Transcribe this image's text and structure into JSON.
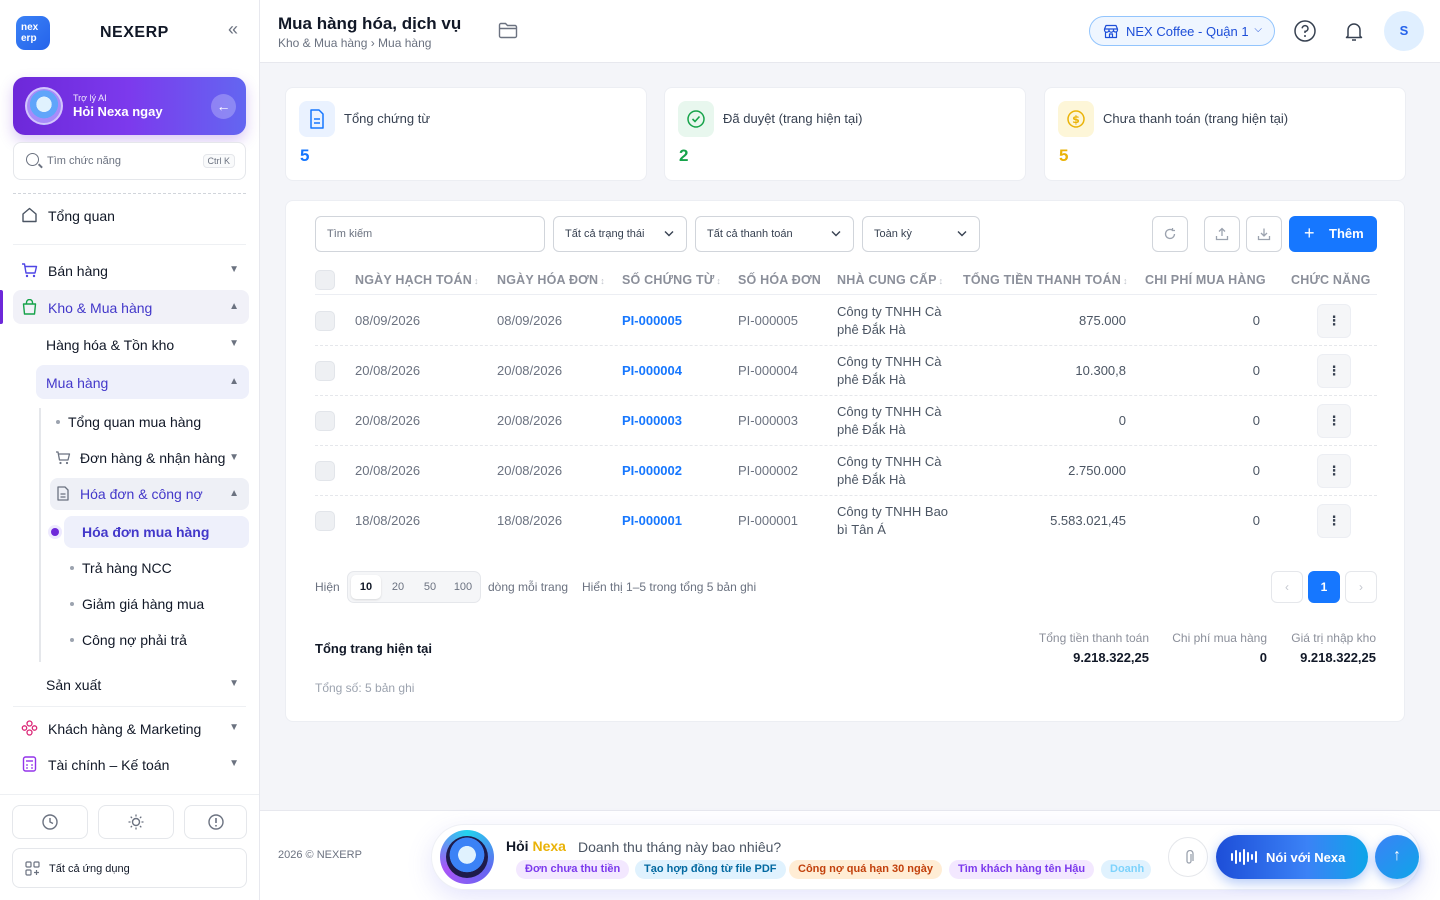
{
  "brand": {
    "logo": "nex erp",
    "name": "NEXERP"
  },
  "ai_card": {
    "small": "Trợ lý AI",
    "big": "Hỏi Nexa ngay"
  },
  "side_search": {
    "placeholder": "Tìm chức năng",
    "shortcut": "Ctrl K"
  },
  "nav": {
    "overview": "Tổng quan",
    "sales": "Bán hàng",
    "warehouse": "Kho & Mua hàng",
    "goods": "Hàng hóa & Tồn kho",
    "purchasing": "Mua hàng",
    "purchase_overview": "Tổng quan mua hàng",
    "orders": "Đơn hàng & nhận hàng",
    "invoices": "Hóa đơn & công nợ",
    "purchase_invoice": "Hóa đơn mua hàng",
    "returns": "Trả hàng NCC",
    "discounts": "Giảm giá hàng mua",
    "payables": "Công nợ phải trả",
    "production": "Sản xuất",
    "customers": "Khách hàng & Marketing",
    "finance": "Tài chính – Kế toán"
  },
  "all_apps": "Tất cả ứng dụng",
  "header": {
    "title": "Mua hàng hóa, dịch vụ",
    "breadcrumb": "Kho & Mua hàng › Mua hàng",
    "branch": "NEX Coffee - Quận 1",
    "avatar": "S"
  },
  "stats": [
    {
      "label": "Tổng chứng từ",
      "value": "5",
      "color": "#1677ff"
    },
    {
      "label": "Đã duyệt (trang hiện tại)",
      "value": "2",
      "color": "#16a34a"
    },
    {
      "label": "Chưa thanh toán (trang hiện tại)",
      "value": "5",
      "color": "#eab308"
    }
  ],
  "filters": {
    "search_placeholder": "Tìm kiếm",
    "status": "Tất cả trạng thái",
    "payment": "Tất cả thanh toán",
    "period": "Toàn kỳ",
    "add": "Thêm"
  },
  "table": {
    "columns": [
      "NGÀY HẠCH TOÁN",
      "NGÀY HÓA ĐƠN",
      "SỐ CHỨNG TỪ",
      "SỐ HÓA ĐƠN",
      "NHÀ CUNG CẤP",
      "TỔNG TIỀN THANH TOÁN",
      "CHI PHÍ MUA HÀNG",
      "CHỨC NĂNG"
    ],
    "rows": [
      {
        "posting_date": "08/09/2026",
        "invoice_date": "08/09/2026",
        "voucher": "PI-000005",
        "invoice_no": "PI-000005",
        "supplier": "Công ty TNHH Cà phê Đắk Hà",
        "total": "875.000",
        "cost": "0"
      },
      {
        "posting_date": "20/08/2026",
        "invoice_date": "20/08/2026",
        "voucher": "PI-000004",
        "invoice_no": "PI-000004",
        "supplier": "Công ty TNHH Cà phê Đắk Hà",
        "total": "10.300,8",
        "cost": "0"
      },
      {
        "posting_date": "20/08/2026",
        "invoice_date": "20/08/2026",
        "voucher": "PI-000003",
        "invoice_no": "PI-000003",
        "supplier": "Công ty TNHH Cà phê Đắk Hà",
        "total": "0",
        "cost": "0"
      },
      {
        "posting_date": "20/08/2026",
        "invoice_date": "20/08/2026",
        "voucher": "PI-000002",
        "invoice_no": "PI-000002",
        "supplier": "Công ty TNHH Cà phê Đắk Hà",
        "total": "2.750.000",
        "cost": "0"
      },
      {
        "posting_date": "18/08/2026",
        "invoice_date": "18/08/2026",
        "voucher": "PI-000001",
        "invoice_no": "PI-000001",
        "supplier": "Công ty TNHH Bao bì Tân Á",
        "total": "5.583.021,45",
        "cost": "0"
      }
    ]
  },
  "pagination": {
    "show_label": "Hiện",
    "options": [
      "10",
      "20",
      "50",
      "100"
    ],
    "selected": "10",
    "per_page_label": "dòng mỗi trang",
    "summary": "Hiển thị 1–5 trong tổng 5 bản ghi",
    "prev": "‹",
    "current_page": "1",
    "next": "›"
  },
  "totals": {
    "title": "Tổng trang hiện tại",
    "count": "Tổng số: 5 bản ghi",
    "items": [
      {
        "label": "Tổng tiền thanh toán",
        "value": "9.218.322,25"
      },
      {
        "label": "Chi phí mua hàng",
        "value": "0"
      },
      {
        "label": "Giá trị nhập kho",
        "value": "9.218.322,25"
      }
    ]
  },
  "footer": {
    "copyright": "2026 © NEXERP"
  },
  "assistant": {
    "title_prefix": "Hỏi ",
    "title_name": "Nexa",
    "placeholder": "Doanh thu tháng này bao nhiêu?",
    "chips": [
      "Đơn chưa thu tiền",
      "Tạo hợp đồng từ file PDF",
      "Công nợ quá hạn 30 ngày",
      "Tìm khách hàng tên Hậu",
      "Doanh"
    ],
    "voice": "Nói với Nexa",
    "send": "↑"
  }
}
